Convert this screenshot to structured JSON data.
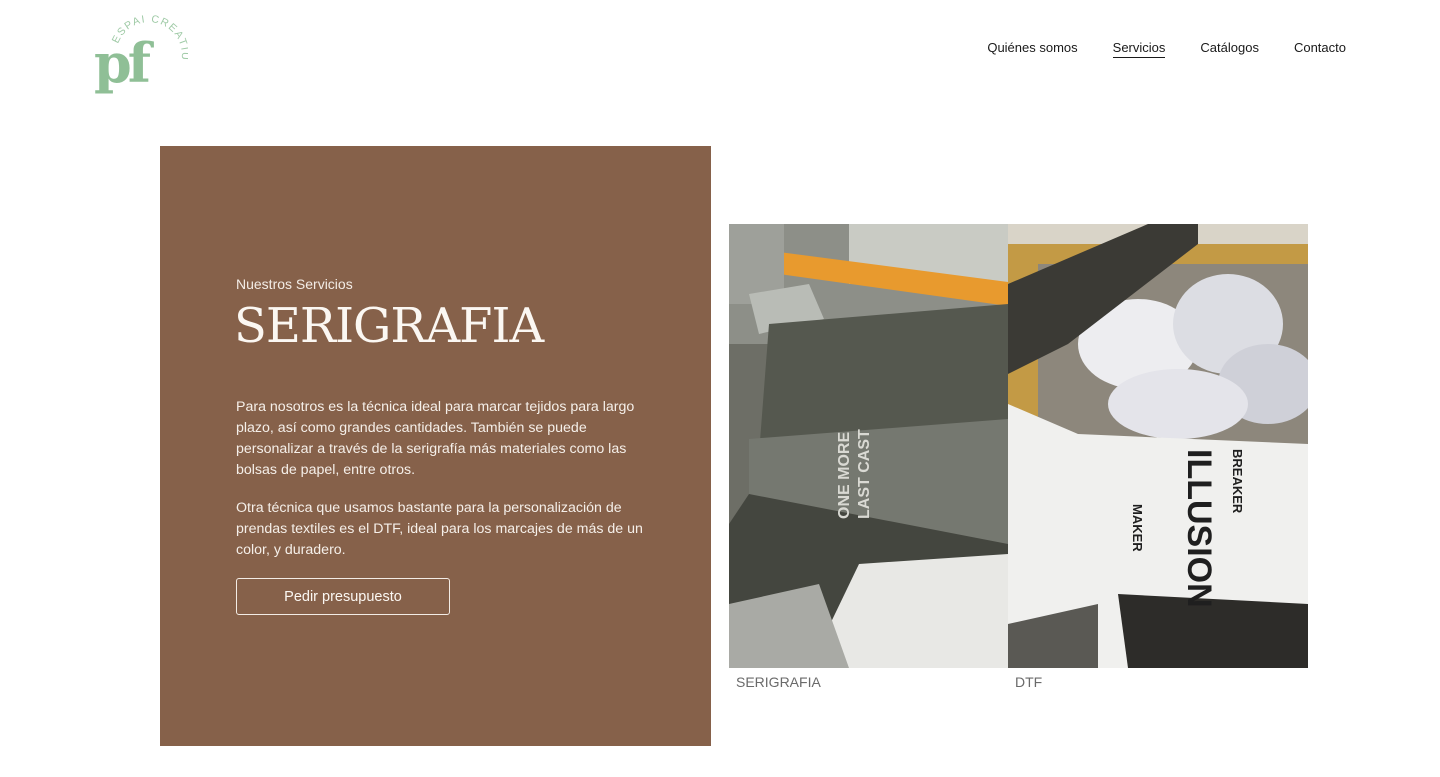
{
  "brand": {
    "logo_mark": "pf",
    "logo_ring_text": "ESPAI CREATIU",
    "logo_color": "#8fbf96"
  },
  "nav": {
    "items": [
      {
        "label": "Quiénes somos",
        "active": false
      },
      {
        "label": "Servicios",
        "active": true
      },
      {
        "label": "Catálogos",
        "active": false
      },
      {
        "label": "Contacto",
        "active": false
      }
    ]
  },
  "hero": {
    "eyebrow": "Nuestros Servicios",
    "title": "SERIGRAFIA",
    "paragraph_1": "Para nosotros es la técnica ideal para marcar tejidos para largo plazo, así como grandes cantidades. También se puede personalizar a través de la serigrafía más materiales como las bolsas de papel, entre otros.",
    "paragraph_2": "Otra técnica que usamos bastante para la personalización de prendas textiles es el DTF, ideal para los marcajes de más de un color, y duradero.",
    "cta_label": "Pedir presupuesto",
    "panel_color": "#86614a"
  },
  "gallery": {
    "items": [
      {
        "caption": "SERIGRAFIA",
        "print_text_1": "ONE MORE",
        "print_text_2": "LAST CAST"
      },
      {
        "caption": "DTF",
        "print_text_1": "ILLUSION",
        "print_text_2": "MAKER",
        "print_text_3": "BREAKER"
      }
    ]
  }
}
